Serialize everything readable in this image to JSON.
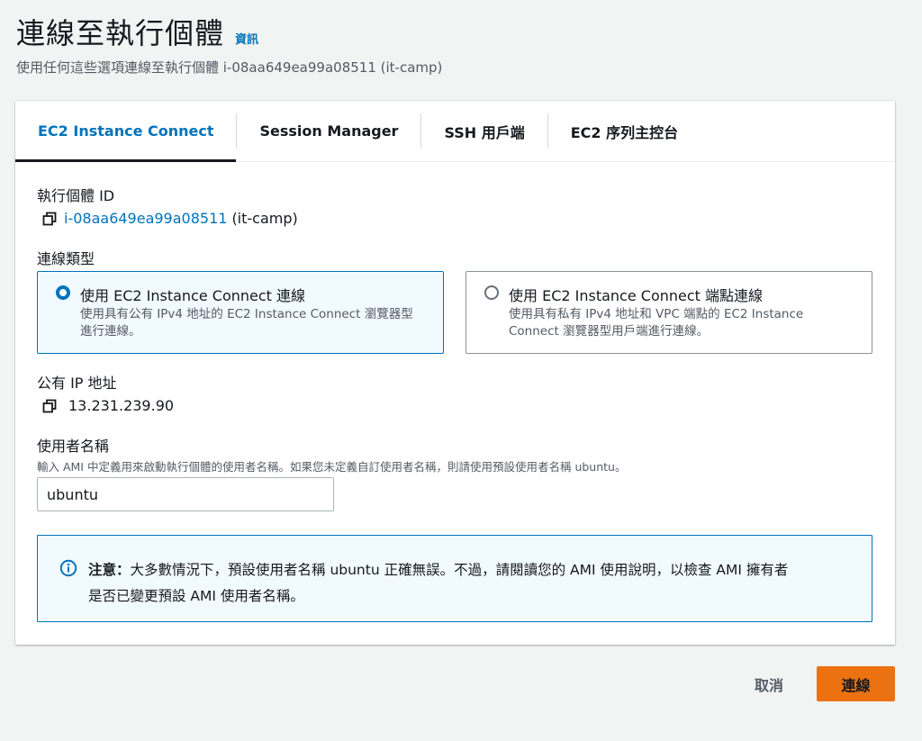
{
  "header": {
    "title": "連線至執行個體",
    "info_link": "資訊",
    "description": "使用任何這些選項連線至執行個體 i-08aa649ea99a08511 (it-camp)"
  },
  "tabs": [
    {
      "label": "EC2 Instance Connect",
      "active": true
    },
    {
      "label": "Session Manager",
      "active": false
    },
    {
      "label": "SSH 用戶端",
      "active": false
    },
    {
      "label": "EC2 序列主控台",
      "active": false
    }
  ],
  "instance": {
    "label": "執行個體 ID",
    "id": "i-08aa649ea99a08511",
    "name": "(it-camp)"
  },
  "connection_type": {
    "label": "連線類型",
    "options": [
      {
        "title": "使用 EC2 Instance Connect 連線",
        "description_line1": "使用具有公有 IPv4 地址的 EC2 Instance Connect 瀏覽器型",
        "description_line2": "進行連線。",
        "selected": true
      },
      {
        "title": "使用 EC2 Instance Connect 端點連線",
        "description_line1": "使用具有私有 IPv4 地址和 VPC 端點的 EC2 Instance",
        "description_line2": "Connect 瀏覽器型用戶端進行連線。",
        "selected": false
      }
    ]
  },
  "public_ip": {
    "label": "公有 IP 地址",
    "value": "13.231.239.90"
  },
  "username": {
    "label": "使用者名稱",
    "hint": "輸入 AMI 中定義用來啟動執行個體的使用者名稱。如果您未定義自訂使用者名稱，則請使用預設使用者名稱 ubuntu。",
    "value": "ubuntu"
  },
  "alert": {
    "bold": "注意：",
    "line1": "大多數情況下，預設使用者名稱 ubuntu 正確無誤。不過，請閱讀您的 AMI 使用說明，以檢查 AMI 擁有者",
    "line2": "是否已變更預設 AMI 使用者名稱。"
  },
  "actions": {
    "cancel": "取消",
    "connect": "連線"
  },
  "colors": {
    "accent": "#0073bb",
    "primary_button": "#ec7211",
    "background": "#f2f3f3"
  }
}
